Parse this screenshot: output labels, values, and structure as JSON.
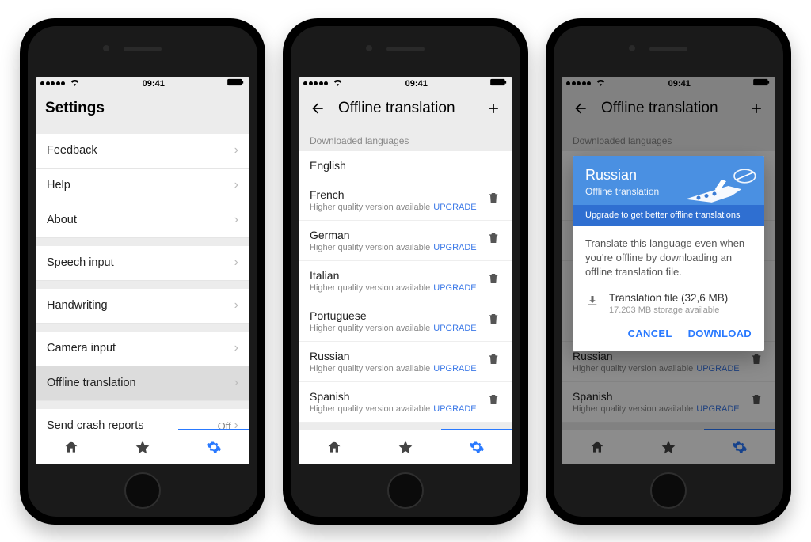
{
  "status": {
    "time": "09:41"
  },
  "settings": {
    "title": "Settings",
    "rows": {
      "feedback": "Feedback",
      "help": "Help",
      "about": "About",
      "speech": "Speech input",
      "handwriting": "Handwriting",
      "camera": "Camera input",
      "offline": "Offline translation",
      "crash": "Send crash reports",
      "crash_value": "Off"
    }
  },
  "offline": {
    "title": "Offline translation",
    "section": "Downloaded languages",
    "sub": "Higher quality version available",
    "upgrade": "UPGRADE",
    "langs": {
      "english": "English",
      "french": "French",
      "german": "German",
      "italian": "Italian",
      "portuguese": "Portuguese",
      "russian": "Russian",
      "spanish": "Spanish"
    }
  },
  "dialog": {
    "name": "Russian",
    "hero_sub": "Offline translation",
    "banner": "Upgrade to get better offline translations",
    "body": "Translate this language even when you're offline by downloading an offline translation file.",
    "file_title": "Translation file (32,6 MB)",
    "file_sub": "17.203 MB storage available",
    "cancel": "CANCEL",
    "download": "DOWNLOAD"
  }
}
